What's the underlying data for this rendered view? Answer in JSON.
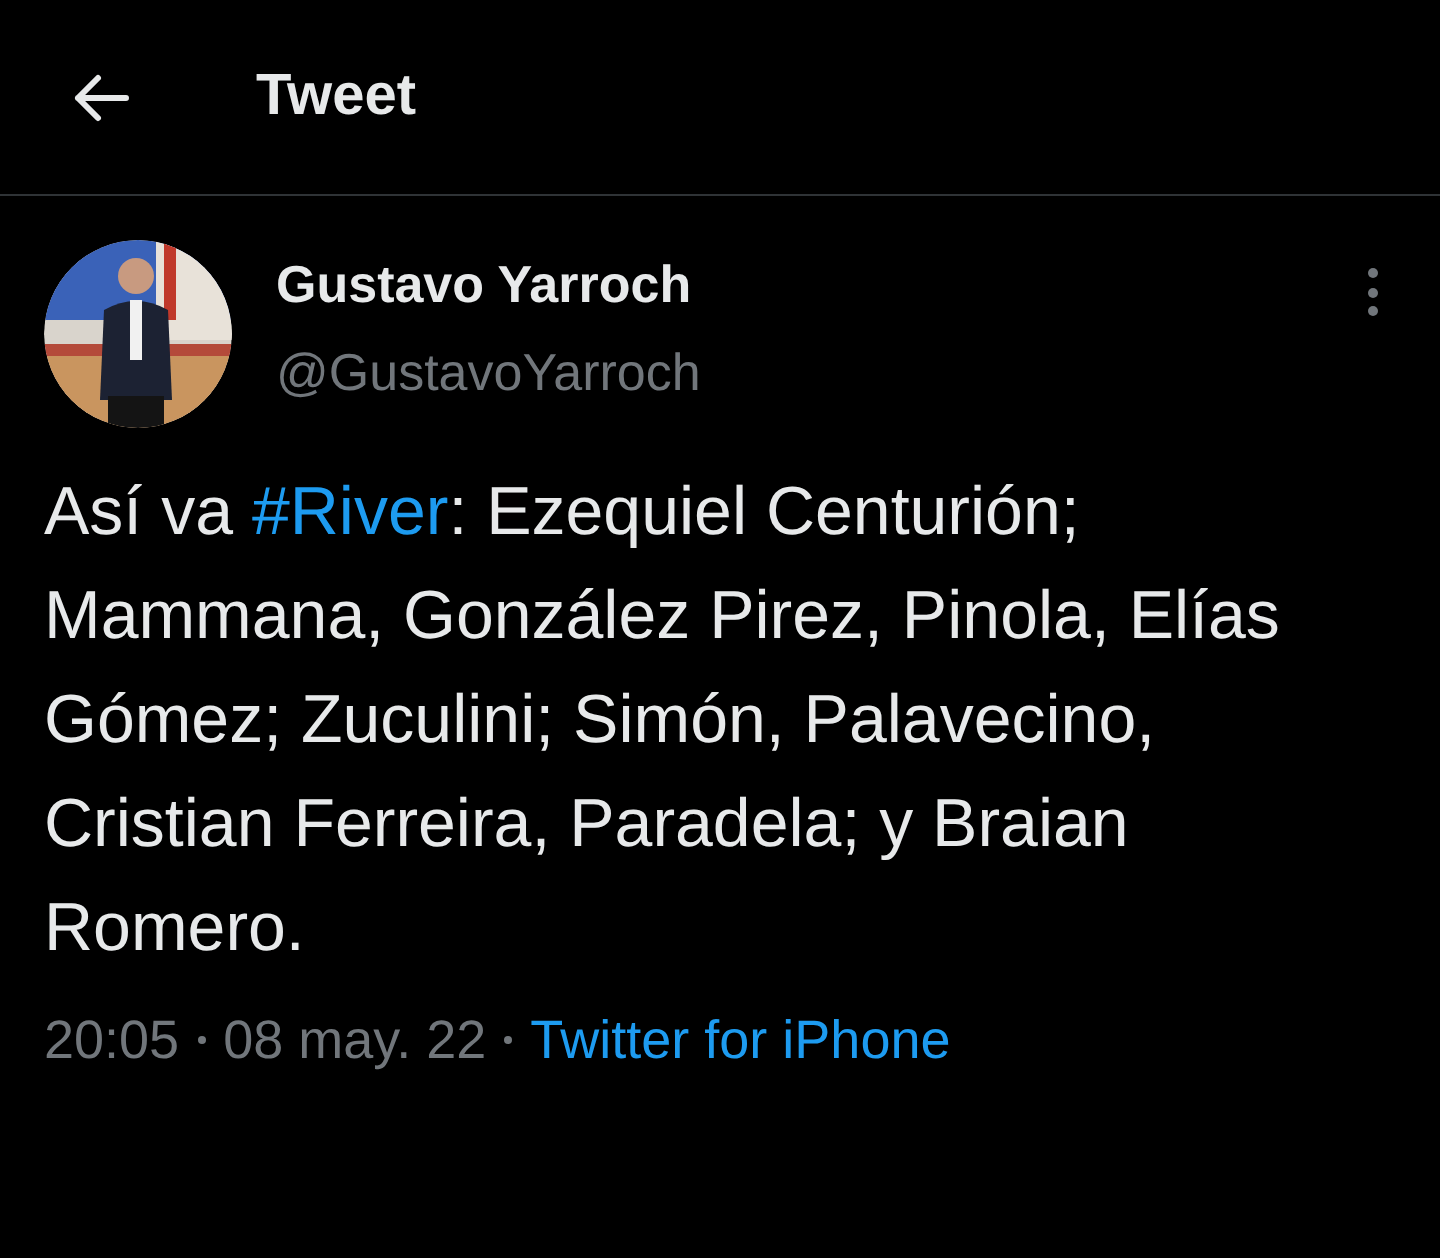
{
  "header": {
    "title": "Tweet"
  },
  "author": {
    "name": "Gustavo Yarroch",
    "handle": "@GustavoYarroch"
  },
  "tweet": {
    "segments": [
      {
        "kind": "text",
        "text": "Así va "
      },
      {
        "kind": "hashtag",
        "text": "#River"
      },
      {
        "kind": "text",
        "text": ": Ezequiel Centurión; Mammana, González Pirez, Pinola, Elías Gómez; Zuculini; Simón, Palavecino, Cristian Ferreira, Paradela; y Braian Romero."
      }
    ]
  },
  "meta": {
    "time": "20:05",
    "date": "08 may. 22",
    "source": "Twitter for iPhone"
  }
}
